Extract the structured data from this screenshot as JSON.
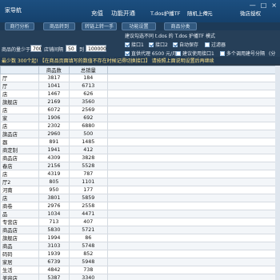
{
  "app": {
    "title": "家导航",
    "menu": [
      "充值",
      "功能开通",
      "T.dos护播TF",
      "随机上传",
      "0元",
      "微店授权"
    ],
    "window_controls": [
      "—",
      "□",
      "×"
    ]
  },
  "tabs": [
    "商行分析",
    "商品转到",
    "转链上转一手",
    "功能设置",
    "商品分类"
  ],
  "options": {
    "row1_text": "建议勾选不同 t.dos 的   T.dos 护播TF 模式",
    "row2": [
      {
        "label": "接口1",
        "checked": true
      },
      {
        "label": "接口2",
        "checked": true
      },
      {
        "label": "自动保存",
        "checked": true
      },
      {
        "label": "过滤器",
        "checked": false
      }
    ],
    "row3": [
      {
        "label": "直供代理 6500 元/月",
        "checked": true
      },
      {
        "label": "建议使用接口1",
        "checked": false
      },
      {
        "label": "多个调用建号分隔",
        "checked": false
      }
    ],
    "commodity_label": "商品的量少于",
    "commodity_value": "700",
    "interval_label": "店铺间隔",
    "interval_value": "50",
    "unit_label": "到",
    "max_value": "100000",
    "hint_right": "(分",
    "notice": "最少数 300个起! 【在商品页面填写的数值不存在时候记得切换接口】 请按照上面说明设置后再继续"
  },
  "table": {
    "headers": [
      "",
      "商品数",
      "总销量",
      ""
    ],
    "rows": [
      [
        "厅",
        "3817",
        "184"
      ],
      [
        "厅",
        "1041",
        "6713"
      ],
      [
        "店",
        "1467",
        "626"
      ],
      [
        "旗舰店",
        "2169",
        "3560"
      ],
      [
        "店",
        "6072",
        "2569"
      ],
      [
        "家",
        "1906",
        "692"
      ],
      [
        "店",
        "2302",
        "6880"
      ],
      [
        "旗品店",
        "2960",
        "500"
      ],
      [
        "器",
        "891",
        "1485"
      ],
      [
        "商定制",
        "1941",
        "412"
      ],
      [
        "商品店",
        "4309",
        "3828"
      ],
      [
        "春店",
        "2156",
        "5528"
      ],
      [
        "店",
        "4319",
        "787"
      ],
      [
        "厅2",
        "805",
        "1101"
      ],
      [
        "河南",
        "950",
        "177"
      ],
      [
        "店",
        "3801",
        "5859"
      ],
      [
        "商卷",
        "2976",
        "2558"
      ],
      [
        "品",
        "1034",
        "4471"
      ],
      [
        "专营店",
        "713",
        "407"
      ],
      [
        "商品店",
        "5830",
        "5721"
      ],
      [
        "旗舰店",
        "1994",
        "86"
      ],
      [
        "商品",
        "3103",
        "5748"
      ],
      [
        "码码",
        "1939",
        "852"
      ],
      [
        "家居",
        "6739",
        "5948"
      ],
      [
        "生活",
        "4842",
        "738"
      ],
      [
        "美容店",
        "5387",
        "3340"
      ],
      [
        "店",
        "947",
        "378"
      ]
    ]
  }
}
